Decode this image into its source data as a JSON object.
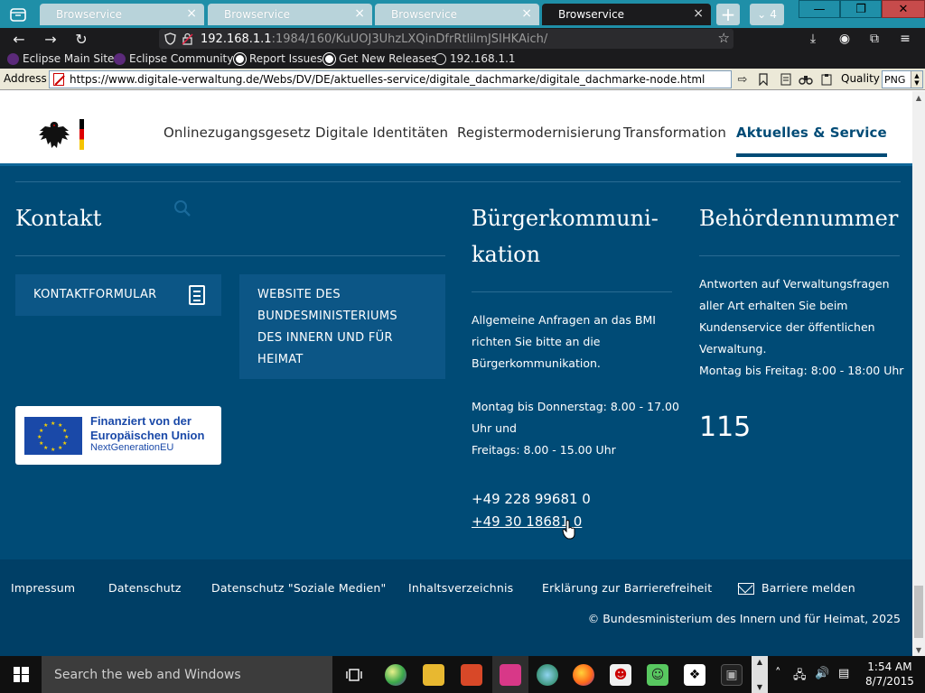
{
  "tabs": [
    {
      "title": "Browservice",
      "close": "×"
    },
    {
      "title": "Browservice",
      "close": "×"
    },
    {
      "title": "Browservice",
      "close": "×"
    },
    {
      "title": "Browservice",
      "close": "×"
    }
  ],
  "tabstrip": {
    "new_tab": "+",
    "tab_count": "4",
    "tab_list_icon": "⌄"
  },
  "window_controls": {
    "minimize": "—",
    "maximize": "❐",
    "close": "✕"
  },
  "navbar": {
    "back": "←",
    "forward": "→",
    "reload": "↻",
    "url_host": "192.168.1.1",
    "url_rest": ":1984/160/KuUOJ3UhzLXQinDfrRtlilmJSIHKAich/",
    "bookmark_star": "☆",
    "download": "⤓",
    "account": "◉",
    "extensions": "⧉",
    "menu": "≡"
  },
  "bookmarks": [
    {
      "label": "Eclipse Main Site",
      "icon": "eclipse-icon"
    },
    {
      "label": "Eclipse Community",
      "icon": "eclipse-icon"
    },
    {
      "label": "Report Issues",
      "icon": "github-icon"
    },
    {
      "label": "Get New Releases",
      "icon": "github-icon"
    },
    {
      "label": "192.168.1.1",
      "icon": "globe-icon"
    }
  ],
  "addressbar": {
    "label": "Address",
    "url": "https://www.digitale-verwaltung.de/Webs/DV/DE/aktuelles-service/digitale_dachmarke/digitale_dachmarke-node.html",
    "go": "⇨",
    "quality_label": "Quality",
    "quality_value": "PNG"
  },
  "site": {
    "nav": [
      {
        "label": "Onlinezugangsgesetz",
        "active": false
      },
      {
        "label": "Digitale Identitäten",
        "active": false
      },
      {
        "label": "Registermodernisierung",
        "active": false
      },
      {
        "label": "Transformation",
        "active": false
      },
      {
        "label": "Aktuelles & Service",
        "active": true
      }
    ],
    "kontakt": {
      "heading": "Kontakt",
      "kontaktformular": "KONTAKTFORMULAR",
      "bmi_line1": "WEBSITE DES",
      "bmi_line2": "BUNDESMINISTERIUMS",
      "bmi_line3": "DES INNERN UND FÜR",
      "bmi_line4": "HEIMAT",
      "eu_line1": "Finanziert von der",
      "eu_line2": "Europäischen Union",
      "eu_line3": "NextGenerationEU"
    },
    "buerger": {
      "heading_line1": "Bürgerkommuni-",
      "heading_line2": "kation",
      "p1_line1": "Allgemeine Anfragen an das BMI",
      "p1_line2": "richten Sie bitte an die",
      "p1_line3": "Bürgerkommunikation.",
      "p2_line1": "Montag bis Donnerstag: 8.00 - 17.00",
      "p2_line2": "Uhr und",
      "p2_line3": "Freitags: 8.00 - 15.00 Uhr",
      "phone1": "+49 228 99681 0",
      "phone2": "+49 30 18681 0"
    },
    "behoerde": {
      "heading": "Behördennummer",
      "line1": "Antworten auf Verwaltungsfragen",
      "line2": "aller Art erhalten Sie beim",
      "line3": "Kundenservice der öffentlichen",
      "line4": "Verwaltung.",
      "line5": "Montag bis Freitag: 8:00 - 18:00 Uhr",
      "number": "115"
    },
    "footer": {
      "links": [
        "Impressum",
        "Datenschutz",
        "Datenschutz \"Soziale Medien\"",
        "Inhaltsverzeichnis",
        "Erklärung zur Barrierefreiheit",
        "Barriere melden"
      ],
      "copyright": "© Bundesministerium des Innern und für Heimat, 2025"
    }
  },
  "taskbar": {
    "search_placeholder": "Search the web and Windows",
    "time": "1:54 AM",
    "date": "8/7/2015"
  },
  "colors": {
    "page_bg": "#004b76",
    "footer_bg": "#003f66",
    "tab_accent": "#1f8fa8"
  }
}
